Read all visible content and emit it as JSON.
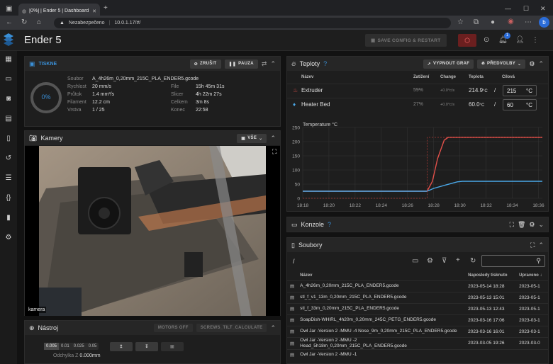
{
  "browser": {
    "tab_title": "[0%] | Ender 5 | Dashboard",
    "security_label": "Nezabezpečeno",
    "url": "10.0.1.17/#/"
  },
  "app": {
    "title": "Ender 5",
    "save_config_label": "SAVE CONFIG & RESTART",
    "notification_count": "1"
  },
  "printing": {
    "title": "TISKNE",
    "cancel_label": "ZRUŠIT",
    "pause_label": "PAUZA",
    "progress": "0%",
    "progress_value": 0,
    "left_fields": [
      {
        "label": "Soubor",
        "value": "A_4h26m_0,20mm_215C_PLA_ENDER5.gcode"
      },
      {
        "label": "Rychlost",
        "value": "20 mm/s"
      },
      {
        "label": "Průtok",
        "value": "1.4 mm³/s"
      },
      {
        "label": "Filament",
        "value": "12.2 cm"
      },
      {
        "label": "Vrstva",
        "value": "1 / 25"
      }
    ],
    "right_fields": [
      {
        "label": "File",
        "value": "15h 45m 31s"
      },
      {
        "label": "Slicer",
        "value": "4h 22m 27s"
      },
      {
        "label": "Celkem",
        "value": "3m 8s"
      },
      {
        "label": "Konec",
        "value": "22:58"
      }
    ]
  },
  "cameras": {
    "title": "Kamery",
    "all_label": "VŠE",
    "caption": "kamera"
  },
  "tool": {
    "title": "Nástroj",
    "motors_off_label": "MOTORS OFF",
    "screws_label": "SCREWS_TILT_CALCULATE",
    "steps": [
      "0.005",
      "0.01",
      "0.025",
      "0.05"
    ],
    "offset_label": "Odchylka Z",
    "offset_value": "0.000mm"
  },
  "temps": {
    "title": "Teploty",
    "graph_off_label": "VYPNOUT GRAF",
    "presets_label": "PŘEDVOLBY",
    "headers": {
      "name": "Název",
      "power": "Zatížení",
      "change": "Change",
      "temp": "Teplota",
      "target": "Cílová"
    },
    "rows": [
      {
        "name": "Extruder",
        "power": "59%",
        "change": "+0.0°c/s",
        "temp": "214.9",
        "unit": "°C",
        "target": "215",
        "target_unit": "°C",
        "color": "#e0504a"
      },
      {
        "name": "Heater Bed",
        "power": "27%",
        "change": "+0.0°c/s",
        "temp": "60.0",
        "unit": "°C",
        "target": "60",
        "target_unit": "°C",
        "color": "#4aa8e8"
      }
    ]
  },
  "chart_data": {
    "type": "line",
    "ylabel": "Temperature °C",
    "x": [
      "18:18",
      "18:20",
      "18:22",
      "18:24",
      "18:26",
      "18:28",
      "18:30",
      "18:32",
      "18:34",
      "18:36"
    ],
    "ylim": [
      0,
      250
    ],
    "yticks": [
      0,
      50,
      100,
      150,
      200,
      250
    ],
    "series": [
      {
        "color": "#e0504a",
        "points": [
          [
            18.0,
            25
          ],
          [
            18.5,
            25
          ],
          [
            19.0,
            25
          ],
          [
            20.0,
            25
          ],
          [
            21.0,
            25
          ],
          [
            22.0,
            25
          ],
          [
            23.0,
            25
          ],
          [
            24.0,
            25
          ],
          [
            25.0,
            25
          ],
          [
            26.0,
            25
          ],
          [
            27.0,
            25
          ],
          [
            27.5,
            25
          ],
          [
            27.9,
            60
          ],
          [
            28.3,
            140
          ],
          [
            28.8,
            205
          ],
          [
            29.1,
            215
          ],
          [
            30.0,
            215
          ],
          [
            31.0,
            215
          ],
          [
            32.0,
            215
          ],
          [
            33.0,
            215
          ],
          [
            34.0,
            215
          ],
          [
            35.0,
            215
          ],
          [
            36.0,
            215
          ],
          [
            36.3,
            215
          ]
        ]
      },
      {
        "color": "#4aa8e8",
        "points": [
          [
            18.0,
            25
          ],
          [
            19.0,
            25
          ],
          [
            20.0,
            25
          ],
          [
            21.0,
            25
          ],
          [
            22.0,
            25
          ],
          [
            23.0,
            25
          ],
          [
            24.0,
            25
          ],
          [
            25.0,
            25
          ],
          [
            26.0,
            25
          ],
          [
            27.0,
            25
          ],
          [
            27.5,
            25
          ],
          [
            28.0,
            35
          ],
          [
            29.0,
            48
          ],
          [
            29.8,
            58
          ],
          [
            30.2,
            60
          ],
          [
            31.0,
            60
          ],
          [
            32.0,
            60
          ],
          [
            33.0,
            60
          ],
          [
            34.0,
            60
          ],
          [
            35.0,
            60
          ],
          [
            36.0,
            60
          ],
          [
            36.3,
            60
          ]
        ]
      },
      {
        "color": "#b03a36",
        "dashed": true,
        "points": [
          [
            18.0,
            0
          ],
          [
            27.5,
            0
          ],
          [
            27.5,
            215
          ],
          [
            36.3,
            215
          ]
        ]
      }
    ]
  },
  "console": {
    "title": "Konzole"
  },
  "files": {
    "title": "Soubory",
    "path": "/",
    "headers": {
      "name": "Název",
      "printed": "Naposledy tisknuto",
      "modified": "Upraveno"
    },
    "rows": [
      {
        "name": "A_4h26m_0,20mm_215C_PLA_ENDER5.gcode",
        "printed": "2023-05-14 18:28",
        "modified": "2023-05-1"
      },
      {
        "name": "stl_f_v1_13m_0,20mm_215C_PLA_ENDER5.gcode",
        "printed": "2023-05-13 15:01",
        "modified": "2023-05-1"
      },
      {
        "name": "stl_f_33m_0,20mm_215C_PLA_ENDER5.gcode",
        "printed": "2023-05-13 12:43",
        "modified": "2023-05-1"
      },
      {
        "name": "SoapDish-WHIRL_4h20m_0,20mm_245C_PETG_ENDER5.gcode",
        "printed": "2023-03-16 17:06",
        "modified": "2023-03-1"
      },
      {
        "name": "Owl Jar -Version 2 -MMU -4 Nose_9m_0,20mm_215C_PLA_ENDER5.gcode",
        "printed": "2023-03-16 16:01",
        "modified": "2023-03-1"
      },
      {
        "name": "Owl Jar -Version 2 -MMU -2 Head_5h18m_0,20mm_215C_PLA_ENDER5.gcode",
        "printed": "2023-03-05 19:26",
        "modified": "2023-03-0"
      },
      {
        "name": "Owl Jar -Version 2 -MMU -1",
        "printed": "",
        "modified": ""
      }
    ]
  }
}
